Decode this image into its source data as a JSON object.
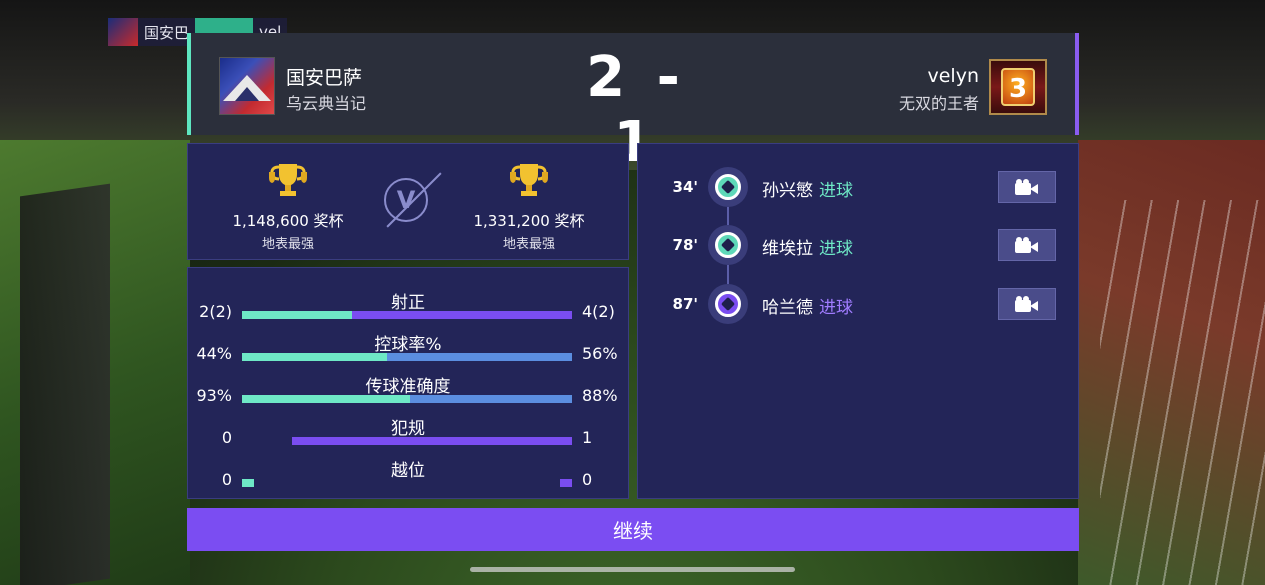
{
  "mini_scorebug": {
    "team": "国安巴",
    "team2": "vel"
  },
  "header": {
    "home": {
      "name": "国安巴萨",
      "subtitle": "乌云典当记"
    },
    "away": {
      "name": "velyn",
      "subtitle": "无双的王者",
      "rank": "3"
    },
    "score": "2 - 1"
  },
  "trophies": {
    "home": {
      "count": "1,148,600 奖杯",
      "label": "地表最强"
    },
    "away": {
      "count": "1,331,200 奖杯",
      "label": "地表最强"
    },
    "vs": "V"
  },
  "stats": [
    {
      "title": "射正",
      "home": "2(2)",
      "away": "4(2)",
      "home_fraction": 0.333,
      "away_color": "#7a4df0"
    },
    {
      "title": "控球率%",
      "home": "44%",
      "away": "56%",
      "home_fraction": 0.44,
      "away_color": "#5b8ee0"
    },
    {
      "title": "传球准确度",
      "home": "93%",
      "away": "88%",
      "home_fraction": 0.51,
      "away_color": "#5b8ee0"
    },
    {
      "title": "犯规",
      "home": "0",
      "away": "1",
      "home_fraction": 0.0,
      "away_color": "#7a4df0"
    },
    {
      "title": "越位",
      "home": "0",
      "away": "0",
      "home_fraction": 0.5,
      "away_color": "#7a4df0"
    }
  ],
  "events": [
    {
      "minute": "34'",
      "player": "孙兴慜",
      "type": "进球",
      "side": "home"
    },
    {
      "minute": "78'",
      "player": "维埃拉",
      "type": "进球",
      "side": "home"
    },
    {
      "minute": "87'",
      "player": "哈兰德",
      "type": "进球",
      "side": "away"
    }
  ],
  "colors": {
    "home": "#6ee8c6",
    "away": "#8a5cf0",
    "button": "#7b4df2",
    "panel": "#232558"
  },
  "continue_label": "继续"
}
